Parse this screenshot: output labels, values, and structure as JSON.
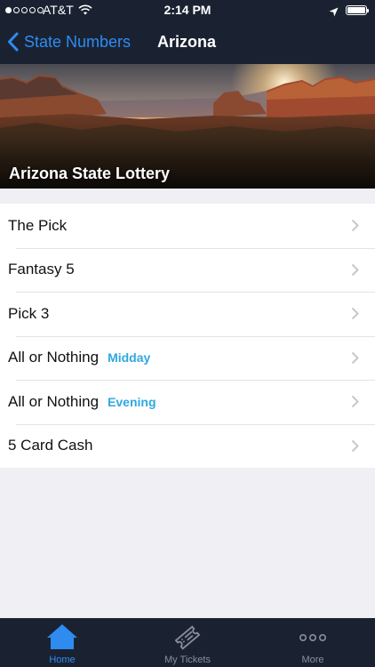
{
  "status_bar": {
    "carrier": "AT&T",
    "time": "2:14 PM"
  },
  "nav": {
    "back_label": "State Numbers",
    "title": "Arizona"
  },
  "hero": {
    "title": "Arizona State Lottery"
  },
  "games": [
    {
      "label": "The Pick",
      "tag": ""
    },
    {
      "label": "Fantasy 5",
      "tag": ""
    },
    {
      "label": "Pick 3",
      "tag": ""
    },
    {
      "label": "All or Nothing",
      "tag": "Midday"
    },
    {
      "label": "All or Nothing",
      "tag": "Evening"
    },
    {
      "label": "5 Card Cash",
      "tag": ""
    }
  ],
  "tabbar": {
    "home": "Home",
    "tickets": "My Tickets",
    "more": "More"
  },
  "colors": {
    "accent": "#2e8cf0",
    "tag": "#2fa8e0",
    "bar": "#1a2232"
  }
}
